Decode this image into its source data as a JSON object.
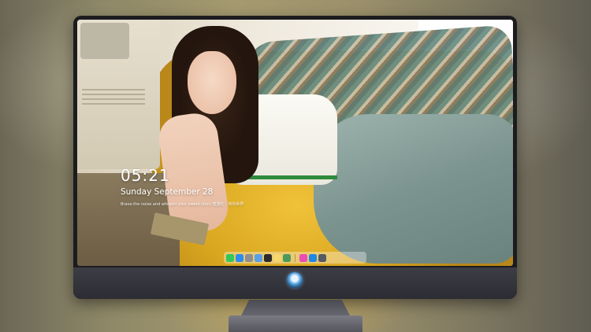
{
  "lockscreen": {
    "time": "05:21",
    "date": "Sunday September  28",
    "quote": "Brave the noise and whisper your sweet story 悠游在 · 你的世界"
  },
  "dock": {
    "icons": [
      {
        "name": "messages-icon",
        "color": "#34c759"
      },
      {
        "name": "finder-icon",
        "color": "#2d8cf0"
      },
      {
        "name": "system-settings-icon",
        "color": "#8e8e93"
      },
      {
        "name": "preview-icon",
        "color": "#5aa0e6"
      },
      {
        "name": "clapper-icon",
        "color": "#2b2b2b"
      },
      {
        "name": "notes-icon",
        "color": "#f5d76e"
      },
      {
        "name": "photos-app-icon",
        "color": "#4c9a5a"
      },
      {
        "name": "music-icon",
        "color": "#e84fb3"
      },
      {
        "name": "app-store-icon",
        "color": "#1e88e5"
      },
      {
        "name": "camera-icon",
        "color": "#555a63"
      }
    ]
  }
}
